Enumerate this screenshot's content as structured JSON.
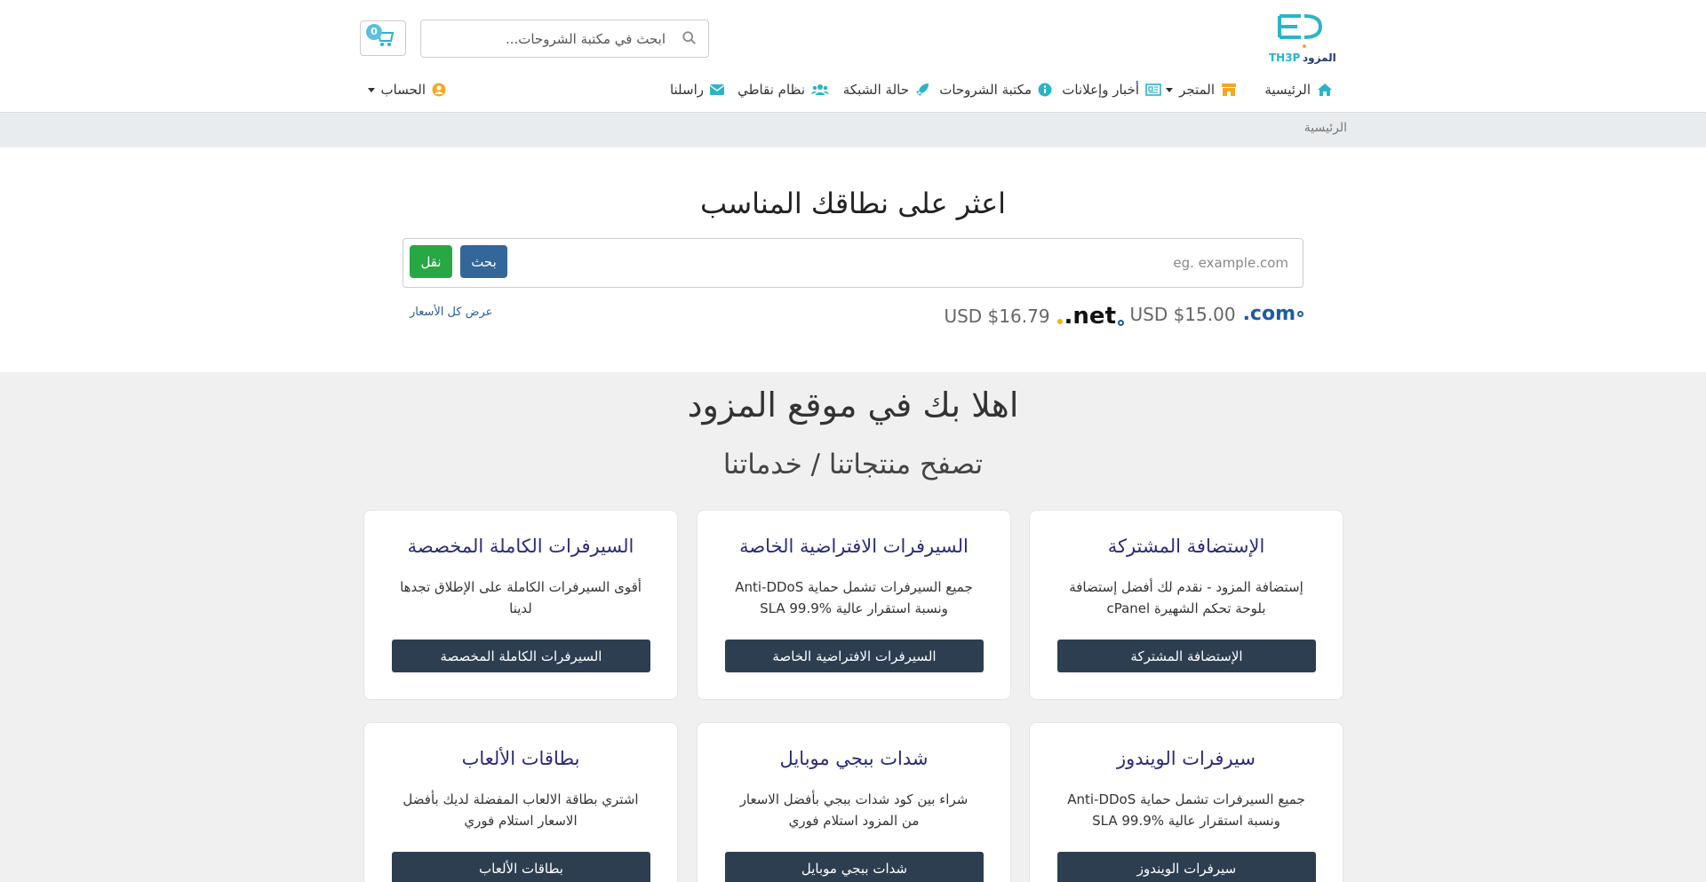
{
  "header": {
    "logo_text": "المزود",
    "logo_mark": "TH3P",
    "search_placeholder": "ابحث في مكتبة الشروحات...",
    "cart_count": "0"
  },
  "nav": {
    "home": "الرئيسية",
    "store": "المتجر",
    "news": "أخبار وإعلانات",
    "kb": "مكتبة الشروحات",
    "network": "حالة الشبكة",
    "points": "نظام نقاطي",
    "contact": "راسلنا",
    "account": "الحساب"
  },
  "breadcrumb": {
    "current": "الرئيسية"
  },
  "domain": {
    "title": "اعثر على نطاقك المناسب",
    "placeholder": "eg. example.com",
    "search_label": "بحث",
    "transfer_label": "نقل",
    "tlds": [
      {
        "name": ".com",
        "price": "USD $15.00"
      },
      {
        "name": ".net",
        "price": "USD $16.79"
      }
    ],
    "view_all": "عرض كل الأسعار"
  },
  "welcome": {
    "title": "اهلا بك في موقع المزود",
    "subtitle": "تصفح منتجاتنا / خدماتنا"
  },
  "cards": [
    {
      "title": "الإستضافة المشتركة",
      "desc": "إستضافة المزود - نقدم لك أفضل إستضافة بلوحة تحكم الشهيرة cPanel",
      "button": "الإستضافة المشتركة"
    },
    {
      "title": "السيرفرات الافتراضية الخاصة",
      "desc": "جميع السيرفرات تشمل حماية Anti-DDoS ونسبة استقرار عالية SLA 99.9%",
      "button": "السيرفرات الافتراضية الخاصة"
    },
    {
      "title": "السيرفرات الكاملة المخصصة",
      "desc": "أقوى السيرفرات الكاملة على الإطلاق تجدها لدينا",
      "button": "السيرفرات الكاملة المخصصة"
    },
    {
      "title": "سيرفرات الويندوز",
      "desc": "جميع السيرفرات تشمل حماية Anti-DDoS ونسبة استقرار عالية SLA 99.9%",
      "button": "سيرفرات الويندوز"
    },
    {
      "title": "شدات ببجي موبايل",
      "desc": "شراء بين كود شدات ببجي بأفضل الاسعار من المزود استلام فوري",
      "button": "شدات ببجي موبايل"
    },
    {
      "title": "بطاقات الألعاب",
      "desc": "اشتري بطاقة الالعاب المفضلة لديك بأفضل الاسعار استلام فوري",
      "button": "بطاقات الألعاب"
    }
  ],
  "colors": {
    "accent": "#2bb4c8",
    "card_title": "#2a2a7a",
    "card_button": "#2d3e50",
    "search_button": "#336699",
    "transfer_button": "#28a745"
  }
}
